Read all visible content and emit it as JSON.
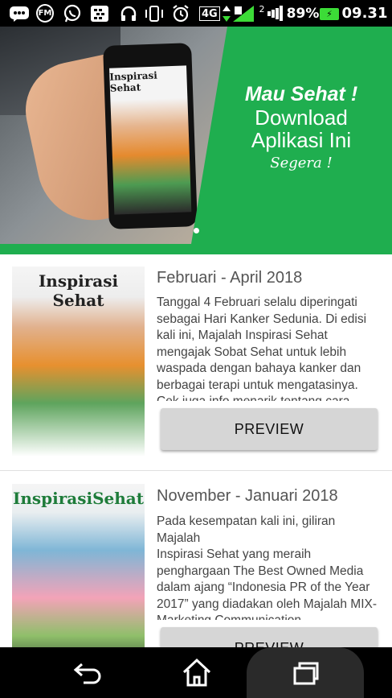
{
  "status_bar": {
    "network_type": "4G",
    "sim_slot": "2",
    "battery_percent": "89%",
    "time": "09.31",
    "icons": [
      "bbm-icon",
      "fm-icon",
      "whatsapp-icon",
      "blackberry-icon",
      "headset-icon",
      "vibrate-icon",
      "alarm-icon",
      "data-arrows-icon",
      "signal-icon",
      "battery-charging-icon"
    ]
  },
  "banner": {
    "phone_title": "Inspirasi Sehat",
    "line1": "Mau Sehat !",
    "line2": "Download",
    "line3": "Aplikasi Ini",
    "line4": "Segera !",
    "page_index": 1,
    "page_count": 1,
    "accent_color": "#1fae4f"
  },
  "editions": [
    {
      "cover_title": "Inspirasi Sehat",
      "title": "Februari - April 2018",
      "description": "Tanggal 4 Februari selalu diperingati sebagai Hari Kanker Sedunia. Di edisi kali ini, Majalah Inspirasi Sehat mengajak Sobat Sehat untuk lebih waspada dengan bahaya kanker dan berbagai terapi untuk mengatasinya. Cek juga info menarik tentang cara",
      "button_label": "PREVIEW"
    },
    {
      "cover_title": "InspirasiSehat",
      "title": "November - Januari 2018",
      "description": "Pada kesempatan kali ini, giliran Majalah\nInspirasi Sehat yang meraih penghargaan The Best Owned Media dalam ajang “Indonesia PR of the Year 2017” yang diadakan oleh Majalah MIX-Marketing Communication.",
      "button_label": "PREVIEW"
    }
  ],
  "nav_bar": {
    "icons": [
      "back-icon",
      "home-icon",
      "recent-apps-icon"
    ]
  }
}
